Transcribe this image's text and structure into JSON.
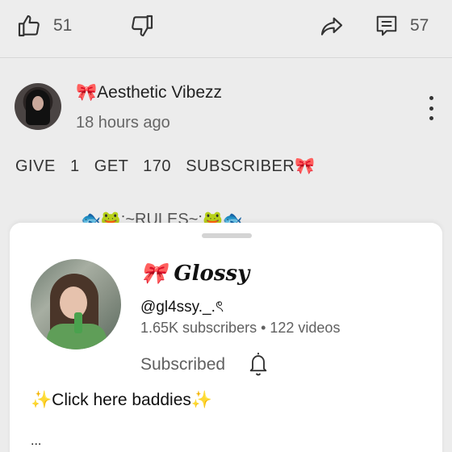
{
  "action_bar": {
    "like_count": "51",
    "comment_count": "57"
  },
  "post": {
    "author": "🎀Aesthetic Vibezz",
    "time": "18 hours ago",
    "text": "GIVE   1   GET   170   SUBSCRIBER🎀",
    "rules_line": "🐟🐸:~RULES~:🐸🐟"
  },
  "channel_card": {
    "name": "🎀 Glossy",
    "handle": "@gl4ssy._.ৎ",
    "stats": "1.65K subscribers • 122 videos",
    "subscribe_state": "Subscribed",
    "description": "✨Click here baddies✨",
    "more": "..."
  },
  "icons": [
    "thumb-up-icon",
    "thumb-down-icon",
    "share-icon",
    "comment-icon",
    "more-vert-icon",
    "bell-icon"
  ]
}
